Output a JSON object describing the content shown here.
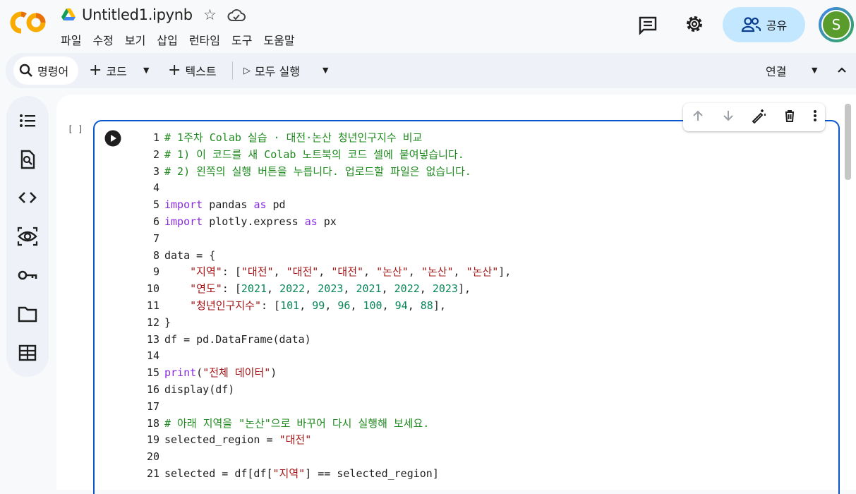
{
  "header": {
    "logo_text": "CO",
    "title": "Untitled1.ipynb",
    "menu": [
      "파일",
      "수정",
      "보기",
      "삽입",
      "런타임",
      "도구",
      "도움말"
    ],
    "share_label": "공유",
    "avatar_initial": "S"
  },
  "toolbar": {
    "command_label": "명령어",
    "add_code_label": "코드",
    "add_text_label": "텍스트",
    "run_all_label": "모두 실행",
    "connect_label": "연결"
  },
  "cell": {
    "bracket": "[ ]",
    "lines": [
      {
        "n": "1",
        "t": "# 1주차 Colab 실습 · 대전·논산 청년인구지수 비교"
      },
      {
        "n": "2",
        "t": "# 1) 이 코드를 새 Colab 노트북의 코드 셀에 붙여넣습니다."
      },
      {
        "n": "3",
        "t": "# 2) 왼쪽의 실행 버튼을 누릅니다. 업로드할 파일은 없습니다."
      },
      {
        "n": "4",
        "t": ""
      },
      {
        "n": "5",
        "t": "import pandas as pd"
      },
      {
        "n": "6",
        "t": "import plotly.express as px"
      },
      {
        "n": "7",
        "t": ""
      },
      {
        "n": "8",
        "t": "data = {"
      },
      {
        "n": "9",
        "t": "    \"지역\": [\"대전\", \"대전\", \"대전\", \"논산\", \"논산\", \"논산\"],"
      },
      {
        "n": "10",
        "t": "    \"연도\": [2021, 2022, 2023, 2021, 2022, 2023],"
      },
      {
        "n": "11",
        "t": "    \"청년인구지수\": [101, 99, 96, 100, 94, 88],"
      },
      {
        "n": "12",
        "t": "}"
      },
      {
        "n": "13",
        "t": "df = pd.DataFrame(data)"
      },
      {
        "n": "14",
        "t": ""
      },
      {
        "n": "15",
        "t": "print(\"전체 데이터\")"
      },
      {
        "n": "16",
        "t": "display(df)"
      },
      {
        "n": "17",
        "t": ""
      },
      {
        "n": "18",
        "t": "# 아래 지역을 \"논산\"으로 바꾸어 다시 실행해 보세요."
      },
      {
        "n": "19",
        "t": "selected_region = \"대전\""
      },
      {
        "n": "20",
        "t": ""
      },
      {
        "n": "21",
        "t": "selected = df[df[\"지역\"] == selected_region]"
      }
    ]
  }
}
